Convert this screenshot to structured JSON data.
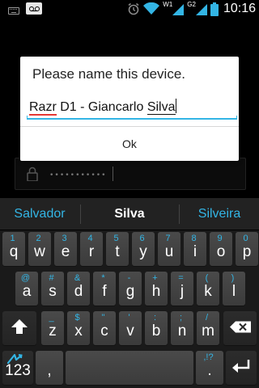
{
  "status_bar": {
    "time": "10:16",
    "network_w": "W1",
    "network_g": "G2",
    "icons": [
      "keyboard-icon",
      "voicemail-icon",
      "alarm-icon",
      "wifi-icon",
      "signal-icon",
      "battery-icon"
    ]
  },
  "background": {
    "password_mask": "•••••••••••"
  },
  "dialog": {
    "title": "Please name this device.",
    "input_value_1": "Razr",
    "input_value_2": " D1 - Giancarlo ",
    "input_value_3": "Silva",
    "ok_label": "Ok"
  },
  "keyboard": {
    "suggestions": [
      "Salvador",
      "Silva",
      "Silveira"
    ],
    "row1": [
      {
        "main": "q",
        "sub": "1"
      },
      {
        "main": "w",
        "sub": "2"
      },
      {
        "main": "e",
        "sub": "3"
      },
      {
        "main": "r",
        "sub": "4"
      },
      {
        "main": "t",
        "sub": "5"
      },
      {
        "main": "y",
        "sub": "6"
      },
      {
        "main": "u",
        "sub": "7"
      },
      {
        "main": "i",
        "sub": "8"
      },
      {
        "main": "o",
        "sub": "9"
      },
      {
        "main": "p",
        "sub": "0"
      }
    ],
    "row2": [
      {
        "main": "a",
        "sub": "@"
      },
      {
        "main": "s",
        "sub": "#"
      },
      {
        "main": "d",
        "sub": "&"
      },
      {
        "main": "f",
        "sub": "*"
      },
      {
        "main": "g",
        "sub": "-"
      },
      {
        "main": "h",
        "sub": "+"
      },
      {
        "main": "j",
        "sub": "="
      },
      {
        "main": "k",
        "sub": "("
      },
      {
        "main": "l",
        "sub": ")"
      }
    ],
    "row3": [
      {
        "main": "z",
        "sub": "_"
      },
      {
        "main": "x",
        "sub": "$"
      },
      {
        "main": "c",
        "sub": "\""
      },
      {
        "main": "v",
        "sub": "'"
      },
      {
        "main": "b",
        "sub": ":"
      },
      {
        "main": "n",
        "sub": ";"
      },
      {
        "main": "m",
        "sub": "/"
      }
    ],
    "symbols_label": "123",
    "comma": ",",
    "period": ".",
    "period_sub": ",!?",
    "icons": [
      "swype-icon",
      "shift-icon",
      "backspace-icon",
      "enter-icon"
    ]
  },
  "colors": {
    "accent": "#33b5e5",
    "spell_error": "#e53935",
    "dialog_bg": "#ffffff",
    "key_bg": "#444444"
  }
}
